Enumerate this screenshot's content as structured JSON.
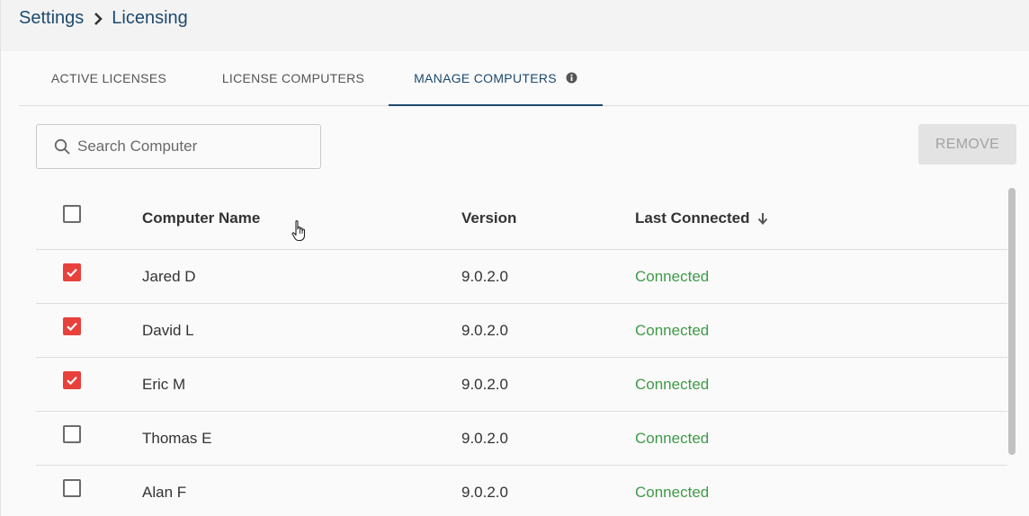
{
  "breadcrumb": {
    "parent": "Settings",
    "current": "Licensing"
  },
  "tabs": [
    {
      "label": "ACTIVE LICENSES",
      "active": false
    },
    {
      "label": "LICENSE COMPUTERS",
      "active": false
    },
    {
      "label": "MANAGE COMPUTERS",
      "active": true
    }
  ],
  "search": {
    "placeholder": "Search Computer",
    "value": ""
  },
  "toolbar": {
    "remove_label": "REMOVE",
    "remove_enabled": false
  },
  "table": {
    "headers": {
      "name": "Computer Name",
      "version": "Version",
      "last_connected": "Last Connected"
    },
    "sort": {
      "column": "last_connected",
      "direction": "descending"
    },
    "rows": [
      {
        "checked": true,
        "name": "Jared D",
        "version": "9.0.2.0",
        "status": "Connected"
      },
      {
        "checked": true,
        "name": "David L",
        "version": "9.0.2.0",
        "status": "Connected"
      },
      {
        "checked": true,
        "name": "Eric M",
        "version": "9.0.2.0",
        "status": "Connected"
      },
      {
        "checked": false,
        "name": "Thomas E",
        "version": "9.0.2.0",
        "status": "Connected"
      },
      {
        "checked": false,
        "name": "Alan F",
        "version": "9.0.2.0",
        "status": "Connected"
      }
    ]
  },
  "colors": {
    "accent": "#1c4a6e",
    "checkbox_checked": "#e8413c",
    "status_connected": "#3f9a48"
  },
  "icons": {
    "breadcrumb_separator": "chevron-right-icon",
    "tab_info": "info-icon",
    "search": "search-icon",
    "sort": "arrow-down-icon",
    "cursor": "hand-pointer-icon"
  }
}
